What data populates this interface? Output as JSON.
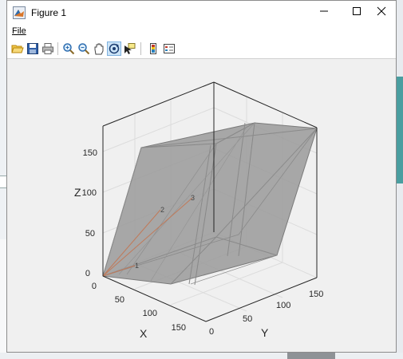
{
  "window": {
    "title": "Figure 1",
    "controls": {
      "minimize": "—",
      "maximize": "☐",
      "close": "✕"
    }
  },
  "menu": {
    "file_label": "File"
  },
  "toolbar": {
    "buttons": [
      {
        "icon": "open-folder-icon"
      },
      {
        "icon": "save-icon"
      },
      {
        "icon": "print-icon"
      },
      {
        "icon": "zoom-in-icon"
      },
      {
        "icon": "zoom-out-icon"
      },
      {
        "icon": "pan-hand-icon"
      },
      {
        "icon": "rotate-3d-icon",
        "active": true
      },
      {
        "icon": "data-cursor-icon"
      },
      {
        "icon": "colorbar-icon"
      },
      {
        "icon": "legend-icon"
      }
    ]
  },
  "chart_data": {
    "type": "3d-surface",
    "xlabel": "X",
    "ylabel": "Y",
    "zlabel": "Z",
    "x_ticks": [
      "0",
      "50",
      "100",
      "150"
    ],
    "y_ticks": [
      "0",
      "50",
      "100",
      "150"
    ],
    "z_ticks": [
      "0",
      "50",
      "100",
      "150"
    ],
    "xlim": [
      0,
      180
    ],
    "ylim": [
      0,
      180
    ],
    "zlim": [
      0,
      180
    ],
    "point_labels": [
      "1",
      "2",
      "3"
    ],
    "grid": true,
    "colors": {
      "surface": "#999999",
      "edges": "#7a7a7a",
      "lines": "#c07a5a",
      "axes": "#262626"
    }
  }
}
